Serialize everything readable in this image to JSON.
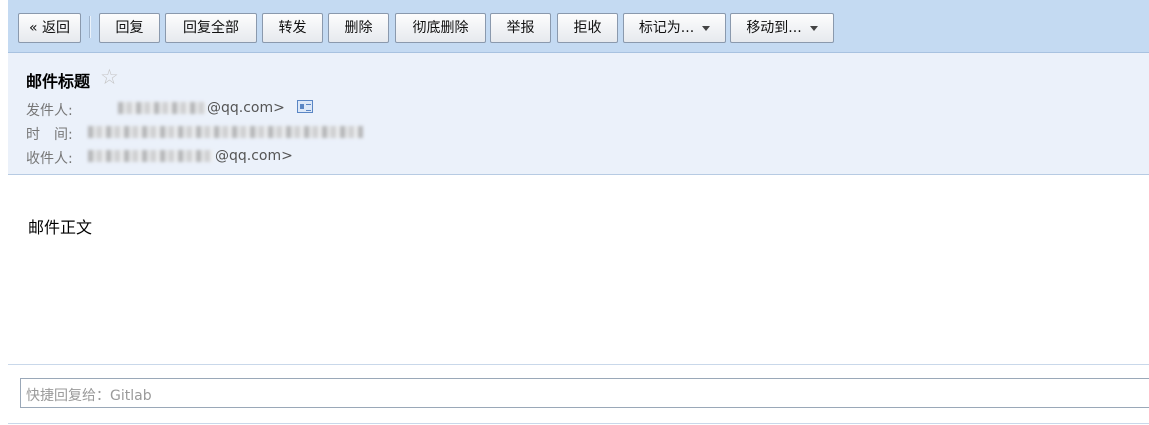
{
  "toolbar": {
    "back": "« 返回",
    "reply": "回复",
    "reply_all": "回复全部",
    "forward": "转发",
    "delete": "删除",
    "delete_permanently": "彻底删除",
    "report": "举报",
    "reject": "拒收",
    "mark_as": "标记为...",
    "move_to": "移动到..."
  },
  "mail": {
    "subject": "邮件标题",
    "star_glyph": "☆",
    "sender_label": "发件人:",
    "sender_suffix": "@qq.com>",
    "time_label": "时　间:",
    "recipient_label": "收件人:",
    "recipient_suffix": "@qq.com>",
    "body": "邮件正文"
  },
  "quick_reply": {
    "placeholder": "快捷回复给：Gitlab"
  },
  "icons": {
    "contact_card": "contact-card-icon",
    "dropdown": "caret-down-icon"
  },
  "colors": {
    "toolbar_bg": "#c4daf2",
    "header_bg": "#ebf1fa",
    "accent_icon": "#5a86c4"
  }
}
